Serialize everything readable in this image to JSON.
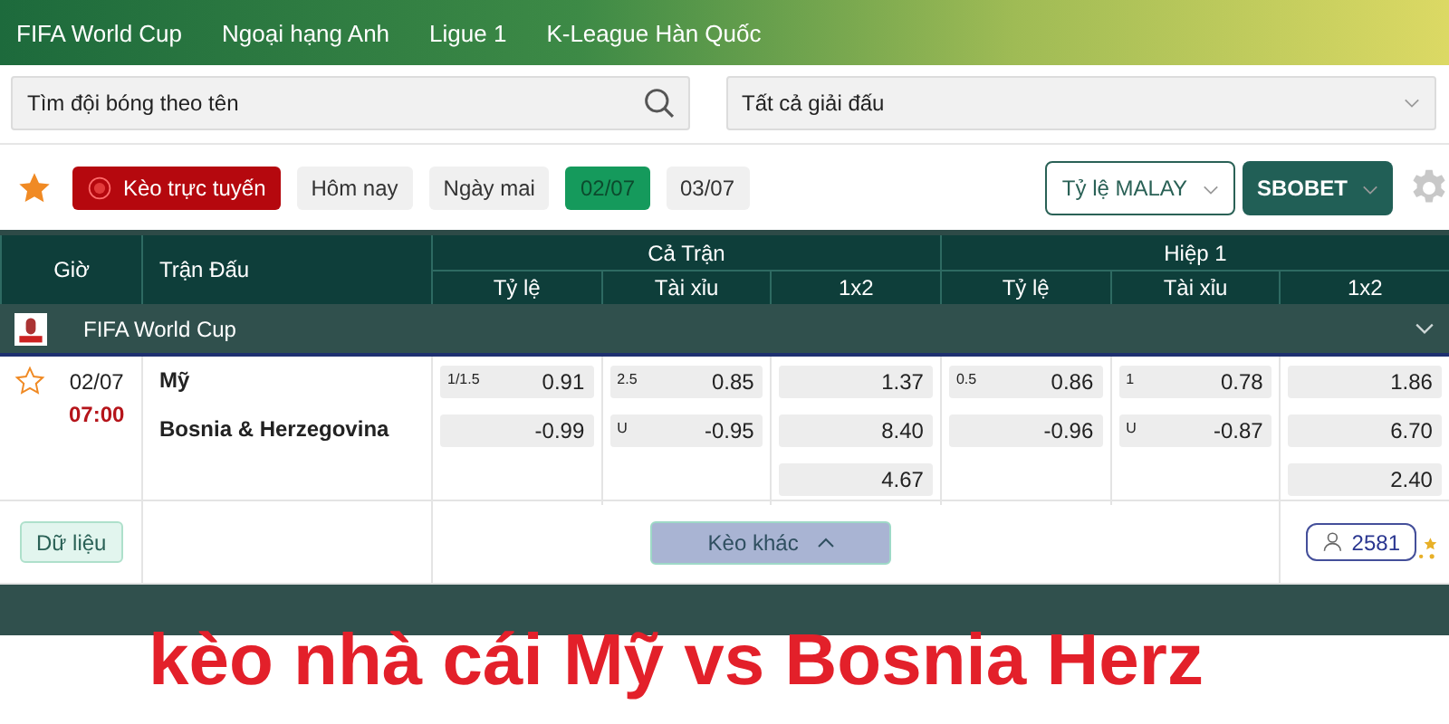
{
  "nav": {
    "items": [
      "FIFA World Cup",
      "Ngoại hạng Anh",
      "Ligue 1",
      "K-League Hàn Quốc"
    ]
  },
  "search": {
    "placeholder": "Tìm đội bóng theo tên"
  },
  "league_select": {
    "value": "Tất cả giải đấu"
  },
  "toolbar": {
    "live_button": "Kèo trực tuyến",
    "days": [
      {
        "label": "Hôm nay",
        "selected": false
      },
      {
        "label": "Ngày mai",
        "selected": false
      },
      {
        "label": "02/07",
        "selected": true
      },
      {
        "label": "03/07",
        "selected": false
      }
    ],
    "odds_type": "Tỷ lệ MALAY",
    "bookmaker": "SBOBET"
  },
  "table": {
    "columns": [
      "Giờ",
      "Trận Đấu"
    ],
    "groups": [
      {
        "title": "Cả Trận",
        "columns": [
          "Tỷ lệ",
          "Tài xỉu",
          "1x2"
        ]
      },
      {
        "title": "Hiệp 1",
        "columns": [
          "Tỷ lệ",
          "Tài xỉu",
          "1x2"
        ]
      }
    ],
    "leagues": [
      {
        "name": "FIFA World Cup",
        "matches": [
          {
            "favorite": false,
            "date": "02/07",
            "time": "07:00",
            "home": "Mỹ",
            "away": "Bosnia & Herzegovina",
            "markets": [
              [
                {
                  "line": "1/1.5",
                  "value": "0.91"
                },
                {
                  "value": "-0.99"
                }
              ],
              [
                {
                  "line": "2.5",
                  "value": "0.85"
                },
                {
                  "line": "U",
                  "value": "-0.95"
                }
              ],
              [
                {
                  "value": "1.37"
                },
                {
                  "value": "8.40"
                },
                {
                  "value": "4.67"
                }
              ],
              [
                {
                  "line": "0.5",
                  "value": "0.86"
                },
                {
                  "value": "-0.96"
                }
              ],
              [
                {
                  "line": "1",
                  "value": "0.78"
                },
                {
                  "line": "U",
                  "value": "-0.87"
                }
              ],
              [
                {
                  "value": "1.86"
                },
                {
                  "value": "6.70"
                },
                {
                  "value": "2.40"
                }
              ]
            ],
            "stats_button": "Dữ liệu",
            "more_button": "Kèo khác",
            "viewers": "2581"
          }
        ]
      }
    ]
  },
  "caption": "kèo nhà cái Mỹ vs Bosnia Herz"
}
